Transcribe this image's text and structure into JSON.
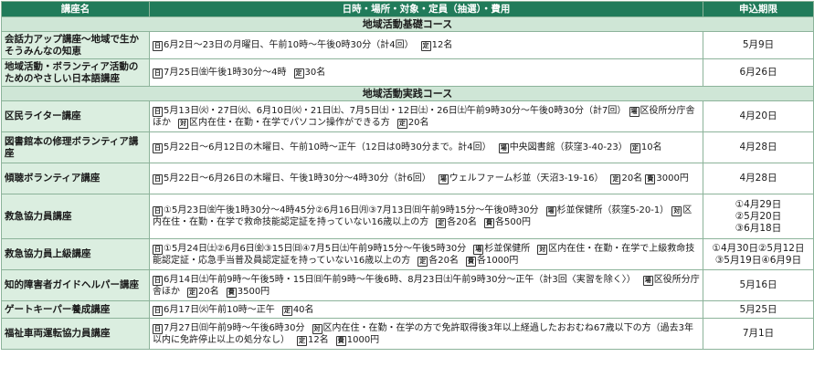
{
  "header": {
    "col_name": "講座名",
    "col_detail": "日時・場所・対象・定員（抽選）・費用",
    "col_deadline": "申込期限"
  },
  "icons": {
    "date": "日",
    "place": "場",
    "target": "対",
    "capacity": "定",
    "fee": "費"
  },
  "sections": [
    {
      "title": "地域活動基礎コース",
      "rows": [
        {
          "name": "会話力アップ講座〜地域で生かそうみんなの知恵",
          "date": "6月2日〜23日の月曜日、午前10時〜午後0時30分（計4回）",
          "capacity": "12名",
          "deadline": "5月9日"
        },
        {
          "name": "地域活動・ボランティア活動のためのやさしい日本語講座",
          "date": "7月25日㈮午後1時30分〜4時",
          "capacity": "30名",
          "deadline": "6月26日"
        }
      ]
    },
    {
      "title": "地域活動実践コース",
      "rows": [
        {
          "name": "区民ライター講座",
          "date": "5月13日㈫・27日㈫、6月10日㈫・21日㈯、7月5日㈯・12日㈯・26日㈯午前9時30分〜午後0時30分（計7回）",
          "place": "区役所分庁舎ほか",
          "target": "区内在住・在勤・在学でパソコン操作ができる方",
          "capacity": "20名",
          "deadline": "4月20日"
        },
        {
          "name": "図書館本の修理ボランティア講座",
          "date": "5月22日〜6月12日の木曜日、午前10時〜正午（12日は0時30分まで。計4回）",
          "place": "中央図書館（荻窪3-40-23）",
          "capacity": "10名",
          "deadline": "4月28日"
        },
        {
          "name": "傾聴ボランティア講座",
          "date": "5月22日〜6月26日の木曜日、午後1時30分〜4時30分（計6回）",
          "place": "ウェルファーム杉並（天沼3-19-16）",
          "capacity": "20名",
          "fee": "3000円",
          "deadline": "4月28日"
        },
        {
          "name": "救急協力員講座",
          "date": "①5月23日㈮午後1時30分〜4時45分②6月16日㈪③7月13日㈰午前9時15分〜午後0時30分",
          "place": "杉並保健所（荻窪5-20-1）",
          "target": "区内在住・在勤・在学で救命技能認定証を持っていない16歳以上の方",
          "capacity": "各20名",
          "fee": "各500円",
          "deadline_lines": [
            "①4月29日",
            "②5月20日",
            "③6月18日"
          ]
        },
        {
          "name": "救急協力員上級講座",
          "date": "①5月24日㈯②6月6日㈮③15日㈰④7月5日㈯午前9時15分〜午後5時30分",
          "place": "杉並保健所",
          "target": "区内在住・在勤・在学で上級救命技能認定証・応急手当普及員認定証を持っていない16歳以上の方",
          "capacity": "各20名",
          "fee": "各1000円",
          "deadline_lines": [
            "①4月30日②5月12日",
            "③5月19日④6月9日"
          ]
        },
        {
          "name": "知的障害者ガイドヘルパー講座",
          "date": "6月14日㈯午前9時〜午後5時・15日㈰午前9時〜午後6時、8月23日㈯午前9時30分〜正午（計3回〈実習を除く〉）",
          "place": "区役所分庁舎ほか",
          "capacity": "20名",
          "fee": "3500円",
          "deadline": "5月16日"
        },
        {
          "name": "ゲートキーパー養成講座",
          "date": "6月17日㈫午前10時〜正午",
          "capacity": "40名",
          "deadline": "5月25日"
        },
        {
          "name": "福祉車両運転協力員講座",
          "date": "7月27日㈰午前9時〜午後6時30分",
          "target": "区内在住・在勤・在学の方で免許取得後3年以上経過したおおむね67歳以下の方（過去3年以内に免許停止以上の処分なし）",
          "capacity": "12名",
          "fee": "1000円",
          "deadline": "7月1日"
        }
      ]
    }
  ]
}
